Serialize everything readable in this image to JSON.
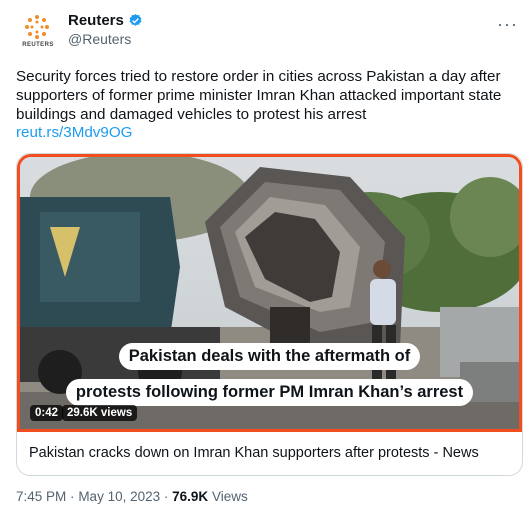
{
  "author": {
    "name": "Reuters",
    "handle": "@Reuters",
    "logo_text": "REUTERS",
    "verified": true
  },
  "tweet": {
    "text": "Security forces tried to restore order in cities across Pakistan a day after supporters of former prime minister Imran Khan attacked important state buildings and damaged vehicles to protest his arrest",
    "link": "reut.rs/3Mdv9OG"
  },
  "video": {
    "caption_line1": "Pakistan deals with the aftermath of",
    "caption_line2": "protests following former PM Imran Khan’s arrest",
    "duration": "0:42",
    "views": "29.6K views"
  },
  "card": {
    "title": "Pakistan cracks down on Imran Khan supporters after protests - News"
  },
  "meta": {
    "time": "7:45 PM",
    "separator": "·",
    "date": "May 10, 2023",
    "views_count": "76.9K",
    "views_label": "Views"
  },
  "colors": {
    "accent": "#1d9bf0",
    "border_highlight": "#f24d1f",
    "logo_orange": "#f28c28"
  }
}
